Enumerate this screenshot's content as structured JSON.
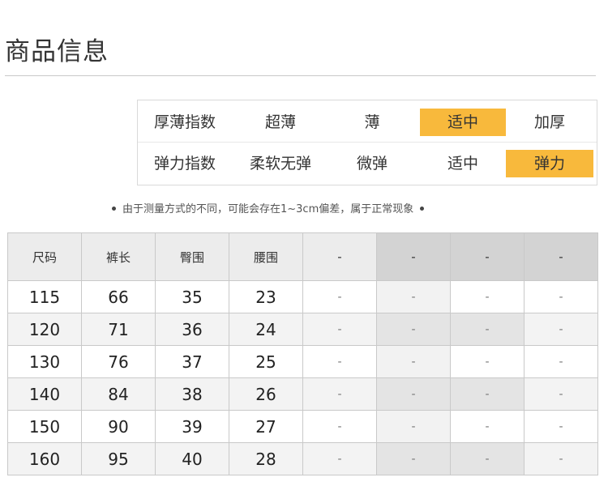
{
  "title": "商品信息",
  "attributes": [
    {
      "label": "厚薄指数",
      "options": [
        "超薄",
        "薄",
        "适中",
        "加厚"
      ],
      "selected_index": 2
    },
    {
      "label": "弹力指数",
      "options": [
        "柔软无弹",
        "微弹",
        "适中",
        "弹力"
      ],
      "selected_index": 3
    }
  ],
  "note": "由于测量方式的不同，可能会存在1~3cm偏差，属于正常现象",
  "highlight_color": "#f8b93c",
  "table": {
    "headers": [
      "尺码",
      "裤长",
      "臀围",
      "腰围",
      "-",
      "-",
      "-",
      "-"
    ],
    "rows": [
      [
        "115",
        "66",
        "35",
        "23",
        "-",
        "-",
        "-",
        "-"
      ],
      [
        "120",
        "71",
        "36",
        "24",
        "-",
        "-",
        "-",
        "-"
      ],
      [
        "130",
        "76",
        "37",
        "25",
        "-",
        "-",
        "-",
        "-"
      ],
      [
        "140",
        "84",
        "38",
        "26",
        "-",
        "-",
        "-",
        "-"
      ],
      [
        "150",
        "90",
        "39",
        "27",
        "-",
        "-",
        "-",
        "-"
      ],
      [
        "160",
        "95",
        "40",
        "28",
        "-",
        "-",
        "-",
        "-"
      ]
    ]
  }
}
